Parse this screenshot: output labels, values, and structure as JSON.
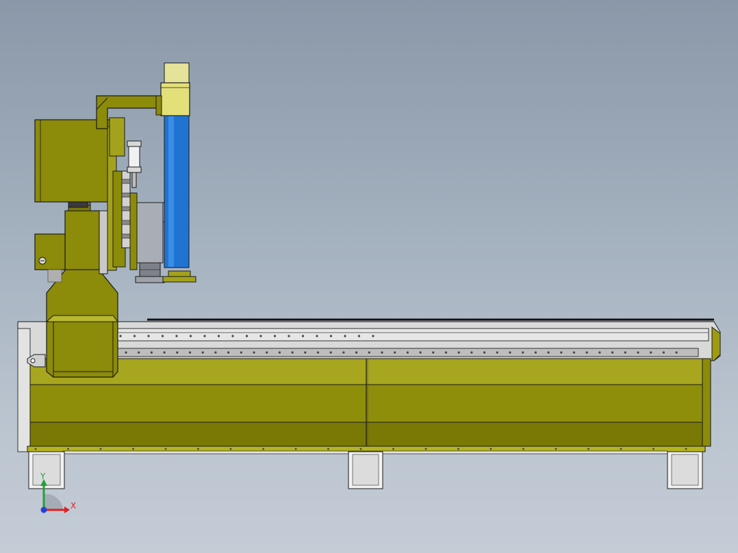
{
  "viewport": {
    "model": "cnc-router-side-view",
    "background_top": "#8a98a9",
    "background_bottom": "#c4ccd6"
  },
  "colors": {
    "olive": "#8c8b0a",
    "olive_light": "#a3a21c",
    "olive_dark": "#6e6d05",
    "blue_column": "#1f74d1",
    "cream": "#e5e29a",
    "rail_gray": "#c8c8c8",
    "edge": "#1a1a1a"
  },
  "triad": {
    "x_label": "X",
    "y_label": "Y",
    "x_color": "#e02020",
    "y_color": "#1fa23a",
    "z_color": "#2340d6"
  }
}
